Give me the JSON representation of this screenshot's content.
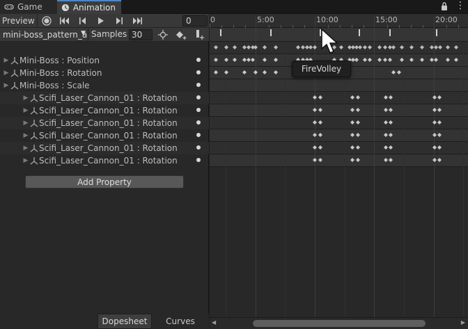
{
  "tabs": {
    "game": "Game",
    "animation": "Animation"
  },
  "toolbar": {
    "preview": "Preview",
    "frame": "0",
    "clip": "mini-boss_pattern_a",
    "samples_label": "Samples",
    "samples": "30"
  },
  "properties": [
    {
      "label": "Mini-Boss : Position"
    },
    {
      "label": "Mini-Boss : Rotation"
    },
    {
      "label": "Mini-Boss : Scale"
    },
    {
      "label": "Scifi_Laser_Cannon_01 : Rotation"
    },
    {
      "label": "Scifi_Laser_Cannon_01 : Rotation"
    },
    {
      "label": "Scifi_Laser_Cannon_01 : Rotation"
    },
    {
      "label": "Scifi_Laser_Cannon_01 : Rotation"
    },
    {
      "label": "Scifi_Laser_Cannon_01 : Rotation"
    },
    {
      "label": "Scifi_Laser_Cannon_01 : Rotation"
    }
  ],
  "add_property": "Add Property",
  "bottom_tabs": {
    "dopesheet": "Dopesheet",
    "curves": "Curves"
  },
  "ruler": [
    "0",
    "5:00",
    "10:00",
    "15:00",
    "20:00"
  ],
  "tooltip": "FireVolley",
  "colors": {
    "accent": "#4f86c6",
    "keyframe": "#c8c8c8",
    "background": "#282828"
  }
}
